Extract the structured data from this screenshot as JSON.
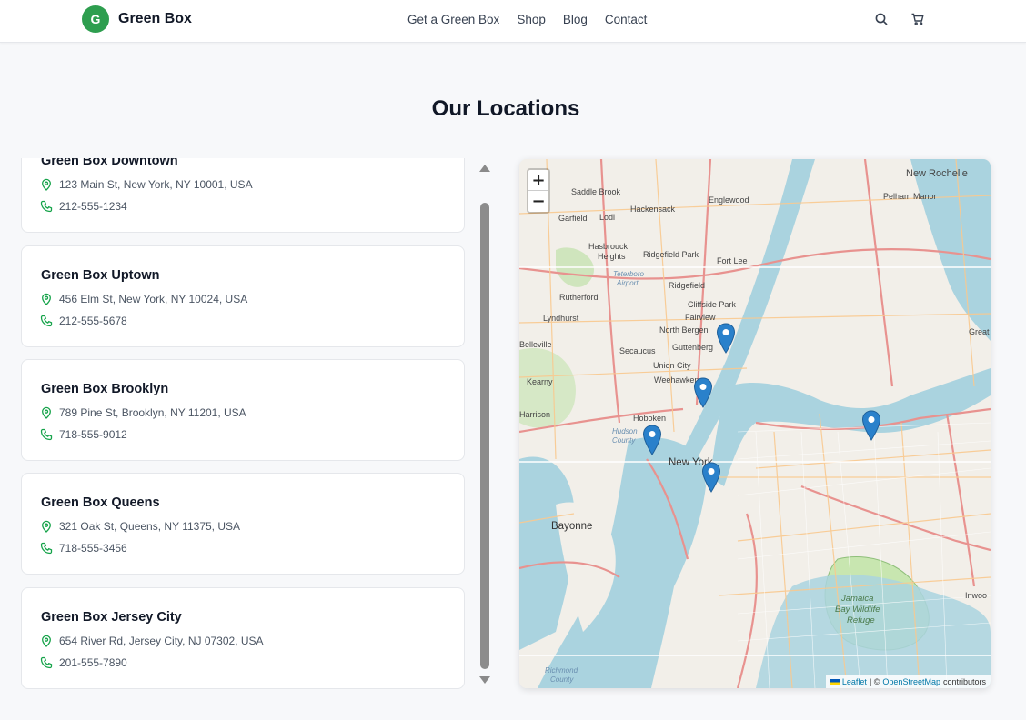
{
  "header": {
    "logo_letter": "G",
    "brand": "Green Box",
    "nav": [
      "Get a Green Box",
      "Shop",
      "Blog",
      "Contact"
    ]
  },
  "page": {
    "title": "Our Locations"
  },
  "locations": [
    {
      "name": "Green Box Downtown",
      "address": "123 Main St, New York, NY 10001, USA",
      "phone": "212-555-1234"
    },
    {
      "name": "Green Box Uptown",
      "address": "456 Elm St, New York, NY 10024, USA",
      "phone": "212-555-5678"
    },
    {
      "name": "Green Box Brooklyn",
      "address": "789 Pine St, Brooklyn, NY 11201, USA",
      "phone": "718-555-9012"
    },
    {
      "name": "Green Box Queens",
      "address": "321 Oak St, Queens, NY 11375, USA",
      "phone": "718-555-3456"
    },
    {
      "name": "Green Box Jersey City",
      "address": "654 River Rd, Jersey City, NJ 07302, USA",
      "phone": "201-555-7890"
    }
  ],
  "map": {
    "zoom_in": "+",
    "zoom_out": "−",
    "attribution": {
      "leaflet": "Leaflet",
      "sep": "| ©",
      "osm": "OpenStreetMap",
      "contributors": "contributors"
    },
    "labels": {
      "new_rochelle": "New Rochelle",
      "pelham_manor": "Pelham Manor",
      "englewood": "Englewood",
      "hackensack": "Hackensack",
      "saddle_brook": "Saddle Brook",
      "garfield": "Garfield",
      "lodi": "Lodi",
      "hasbrouck": "Hasbrouck",
      "heights": "Heights",
      "ridgefield_park": "Ridgefield Park",
      "fort_lee": "Fort Lee",
      "ridgefield": "Ridgefield",
      "teterboro": "Teterboro",
      "airport": "Airport",
      "rutherford": "Rutherford",
      "lyndhurst": "Lyndhurst",
      "cliffside_park": "Cliffside Park",
      "fairview": "Fairview",
      "north_bergen": "North Bergen",
      "secaucus": "Secaucus",
      "guttenberg": "Guttenberg",
      "belleville": "Belleville",
      "union_city": "Union City",
      "weehawken": "Weehawken",
      "kearny": "Kearny",
      "hoboken": "Hoboken",
      "harrison": "Harrison",
      "hudson": "Hudson",
      "county": "County",
      "new_york": "New York",
      "bayonne": "Bayonne",
      "jamaica": "Jamaica",
      "bay_wildlife": "Bay Wildlife",
      "refuge": "Refuge",
      "richmond": "Richmond",
      "richmond_county": "County",
      "inwood": "Inwoo",
      "great": "Great"
    },
    "colors": {
      "water": "#aad3df",
      "land": "#f2efe9",
      "park": "#c8e6b0",
      "motorway": "#e8928f",
      "primary": "#f9c98f",
      "marker": "#2a81cb"
    }
  }
}
